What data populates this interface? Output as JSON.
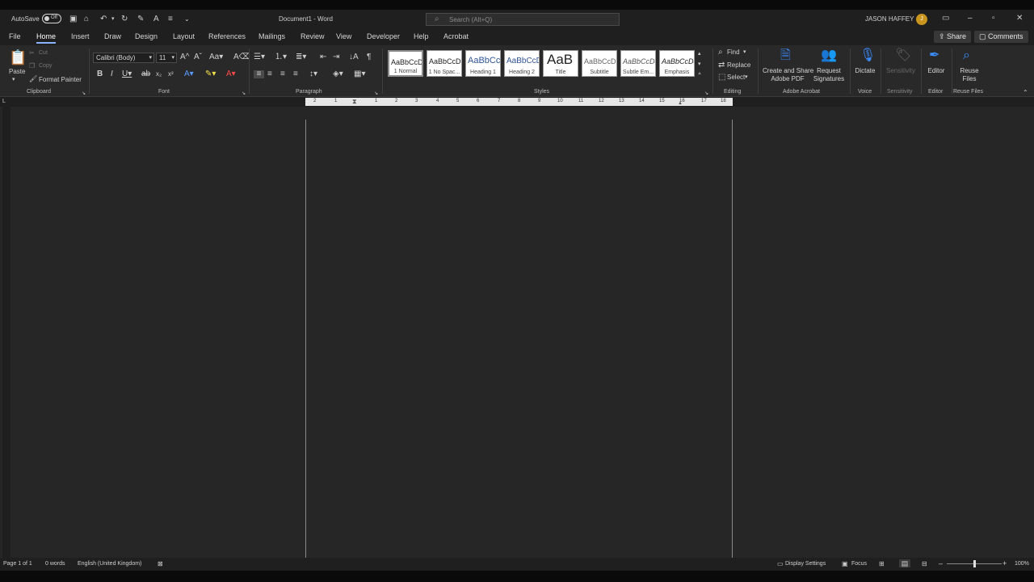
{
  "titlebar": {
    "autosave_label": "AutoSave",
    "autosave_state": "Off",
    "doc_title": "Document1 - Word",
    "search_placeholder": "Search (Alt+Q)",
    "user_name": "JASON HAFFEY",
    "avatar_initial": "J"
  },
  "tabs": [
    "File",
    "Home",
    "Insert",
    "Draw",
    "Design",
    "Layout",
    "References",
    "Mailings",
    "Review",
    "View",
    "Developer",
    "Help",
    "Acrobat"
  ],
  "active_tab": "Home",
  "share_label": "Share",
  "comments_label": "Comments",
  "clipboard": {
    "paste": "Paste",
    "cut": "Cut",
    "copy": "Copy",
    "format_painter": "Format Painter",
    "group": "Clipboard"
  },
  "font": {
    "name": "Calibri (Body)",
    "size": "11",
    "group": "Font"
  },
  "paragraph_group": "Paragraph",
  "styles": {
    "group": "Styles",
    "items": [
      {
        "sample": "AaBbCcDc",
        "name": "1 Normal"
      },
      {
        "sample": "AaBbCcDc",
        "name": "1 No Spac..."
      },
      {
        "sample": "AaBbCc",
        "name": "Heading 1"
      },
      {
        "sample": "AaBbCcD",
        "name": "Heading 2"
      },
      {
        "sample": "AaB",
        "name": "Title"
      },
      {
        "sample": "AaBbCcD",
        "name": "Subtitle"
      },
      {
        "sample": "AaBbCcDd",
        "name": "Subtle Em..."
      },
      {
        "sample": "AaBbCcDd",
        "name": "Emphasis"
      }
    ]
  },
  "editing": {
    "find": "Find",
    "replace": "Replace",
    "select": "Select",
    "group": "Editing"
  },
  "acrobat": {
    "create_share_1": "Create and Share",
    "create_share_2": "Adobe PDF",
    "request_1": "Request",
    "request_2": "Signatures",
    "group": "Adobe Acrobat"
  },
  "voice": {
    "dictate": "Dictate",
    "group": "Voice"
  },
  "sensitivity": {
    "label": "Sensitivity",
    "group": "Sensitivity"
  },
  "editor": {
    "label": "Editor",
    "group": "Editor"
  },
  "reuse": {
    "label_1": "Reuse",
    "label_2": "Files",
    "group": "Reuse Files"
  },
  "ruler_numbers": [
    "2",
    "1",
    "1",
    "2",
    "3",
    "4",
    "5",
    "6",
    "7",
    "8",
    "9",
    "10",
    "11",
    "12",
    "13",
    "14",
    "15",
    "16",
    "17",
    "18"
  ],
  "status": {
    "page": "Page 1 of 1",
    "words": "0 words",
    "language": "English (United Kingdom)",
    "display_settings": "Display Settings",
    "focus": "Focus",
    "zoom": "100%"
  }
}
